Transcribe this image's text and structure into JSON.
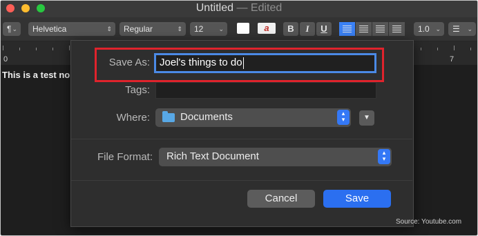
{
  "window": {
    "title": "Untitled",
    "title_separator": "—",
    "status": "Edited"
  },
  "toolbar": {
    "paragraph_style": "¶",
    "font_family": "Helvetica",
    "typeface": "Regular",
    "font_size": "12",
    "text_color": "#ffffff",
    "highlight_glyph": "a",
    "bold": "B",
    "italic": "I",
    "underline": "U",
    "active_alignment": "left",
    "line_spacing": "1.0",
    "list_style_icon": "list-icon"
  },
  "ruler": {
    "start_number": "0",
    "end_number": "7"
  },
  "document": {
    "visible_text": "This is a test no"
  },
  "dialog": {
    "save_as_label": "Save As:",
    "save_as_value": "Joel's things to do",
    "tags_label": "Tags:",
    "tags_value": "",
    "where_label": "Where:",
    "where_value": "Documents",
    "where_icon": "folder-icon",
    "file_format_label": "File Format:",
    "file_format_value": "Rich Text Document",
    "cancel_label": "Cancel",
    "save_label": "Save"
  },
  "colors": {
    "accent": "#2b6ff0",
    "focus_ring": "#4b8ae6",
    "annotation_box": "#e0232c"
  },
  "caption": "Source: Youtube.com"
}
